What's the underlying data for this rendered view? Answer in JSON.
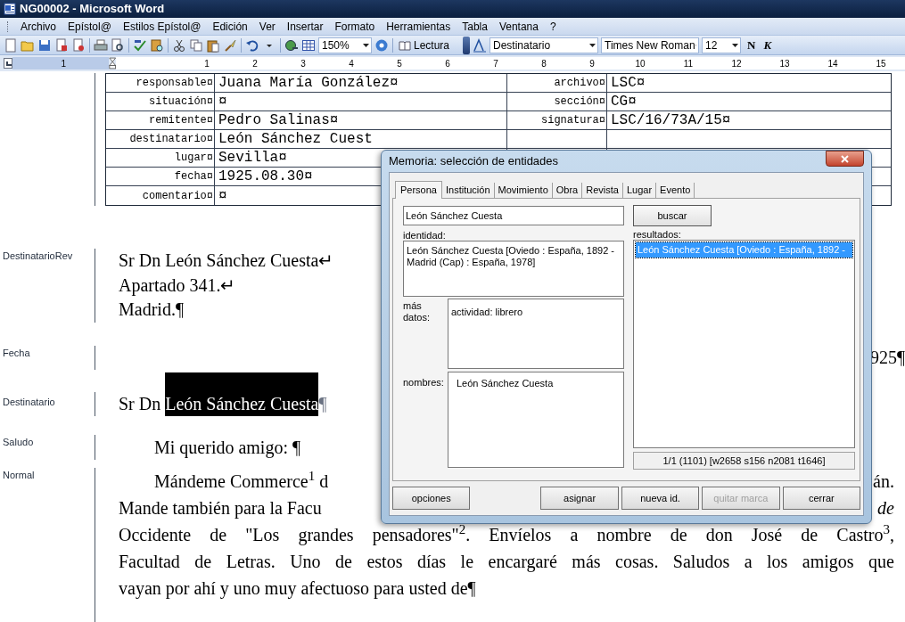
{
  "window": {
    "title": "NG00002 - Microsoft Word"
  },
  "menu": [
    "Archivo",
    "Epístol@",
    "Estilos Epístol@",
    "Edición",
    "Ver",
    "Insertar",
    "Formato",
    "Herramientas",
    "Tabla",
    "Ventana",
    "?"
  ],
  "toolbar": {
    "zoom": "150%",
    "reading_button": "Lectura",
    "style": "Destinatario",
    "font": "Times New Roman",
    "size": "12",
    "bold_button": "N",
    "italic_button": "K"
  },
  "ruler": {
    "left_numbers": [
      "1"
    ],
    "numbers": [
      "1",
      "2",
      "3",
      "4",
      "5",
      "6",
      "7",
      "8",
      "9",
      "10",
      "11",
      "12",
      "13",
      "14",
      "15"
    ]
  },
  "metadata_table": {
    "rows": [
      {
        "label": "responsable¤",
        "value": "Juana María González¤",
        "label_2": "archivo¤",
        "value_2": "LSC¤"
      },
      {
        "label": "situación¤",
        "value": "¤",
        "label_2": "sección¤",
        "value_2": "CG¤"
      },
      {
        "label": "remitente¤",
        "value": "Pedro Salinas¤",
        "label_2": "signatura¤",
        "value_2": "LSC/16/73A/15¤"
      },
      {
        "label": "destinatario¤",
        "value": "León Sánchez Cuest"
      },
      {
        "label": "lugar¤",
        "value": "Sevilla¤"
      },
      {
        "label": "fecha¤",
        "value": "1925.08.30¤"
      },
      {
        "label": "comentario¤",
        "value": "¤"
      }
    ]
  },
  "document": {
    "paragraphs": [
      {
        "style": "DestinatarioRev",
        "kind": "address",
        "lines": [
          {
            "text": "Sr Dn León Sánchez Cuesta↵"
          },
          {
            "text": "Apartado 341.↵"
          },
          {
            "text": "Madrid.¶"
          }
        ]
      },
      {
        "style": "Fecha",
        "kind": "date",
        "lines": [
          {
            "text": "925¶"
          }
        ]
      },
      {
        "style": "Destinatario",
        "kind": "address",
        "lines": [
          {
            "text": "Sr Dn ",
            "selected_text": "León Sánchez Cuesta",
            "after": "¶"
          }
        ]
      },
      {
        "style": "Saludo",
        "kind": "salutation",
        "lines": [
          {
            "text": "Mi querido amigo: ¶"
          }
        ]
      },
      {
        "style": "Normal",
        "kind": "body",
        "lines": [
          {
            "text": "Mándeme Commerce$^{1}$ d",
            "tail": "án.",
            "tail_italic": false
          },
          {
            "text": "Mande también para la Facu",
            "tail": "de",
            "tail_italic": true
          },
          {
            "text": "Occidente de \"Los grandes pensadores\"$^{2}$. Envíelos a nombre de don José de Castro$^{3}$,",
            "justify": true
          },
          {
            "text": "Facultad de Letras. Uno de estos días le encargaré más cosas. Saludos a los amigos que",
            "justify": true
          },
          {
            "text": "vayan por ahí y uno muy afectuoso para usted de¶",
            "justify": false
          }
        ]
      }
    ]
  },
  "dialog": {
    "title": "Memoria: selección de entidades",
    "tabs": [
      {
        "label": "Persona",
        "selected": true
      },
      {
        "label": "Institución",
        "selected": false
      },
      {
        "label": "Movimiento",
        "selected": false
      },
      {
        "label": "Obra",
        "selected": false
      },
      {
        "label": "Revista",
        "selected": false
      },
      {
        "label": "Lugar",
        "selected": false
      },
      {
        "label": "Evento",
        "selected": false
      }
    ],
    "search_value": "León Sánchez Cuesta",
    "search_button": "buscar",
    "identity_label": "identidad:",
    "identity": "León Sánchez Cuesta [Oviedo : España, 1892 - Madrid (Cap) : España, 1978]",
    "more_label": "más datos:",
    "more": "actividad: librero",
    "names_label": "nombres:",
    "names": [
      "León Sánchez Cuesta"
    ],
    "results_label": "resultados:",
    "results": [
      {
        "text": "León Sánchez Cuesta [Oviedo : España, 1892 -",
        "selected": true
      }
    ],
    "results_status": "1/1 (1101) [w2658 s156 n2081 t1646]",
    "buttons": [
      {
        "label": "opciones",
        "disabled": false
      },
      {
        "label": "asignar",
        "disabled": false
      },
      {
        "label": "nueva id.",
        "disabled": false
      },
      {
        "label": "quitar marca",
        "disabled": true
      },
      {
        "label": "cerrar",
        "disabled": false
      }
    ]
  }
}
